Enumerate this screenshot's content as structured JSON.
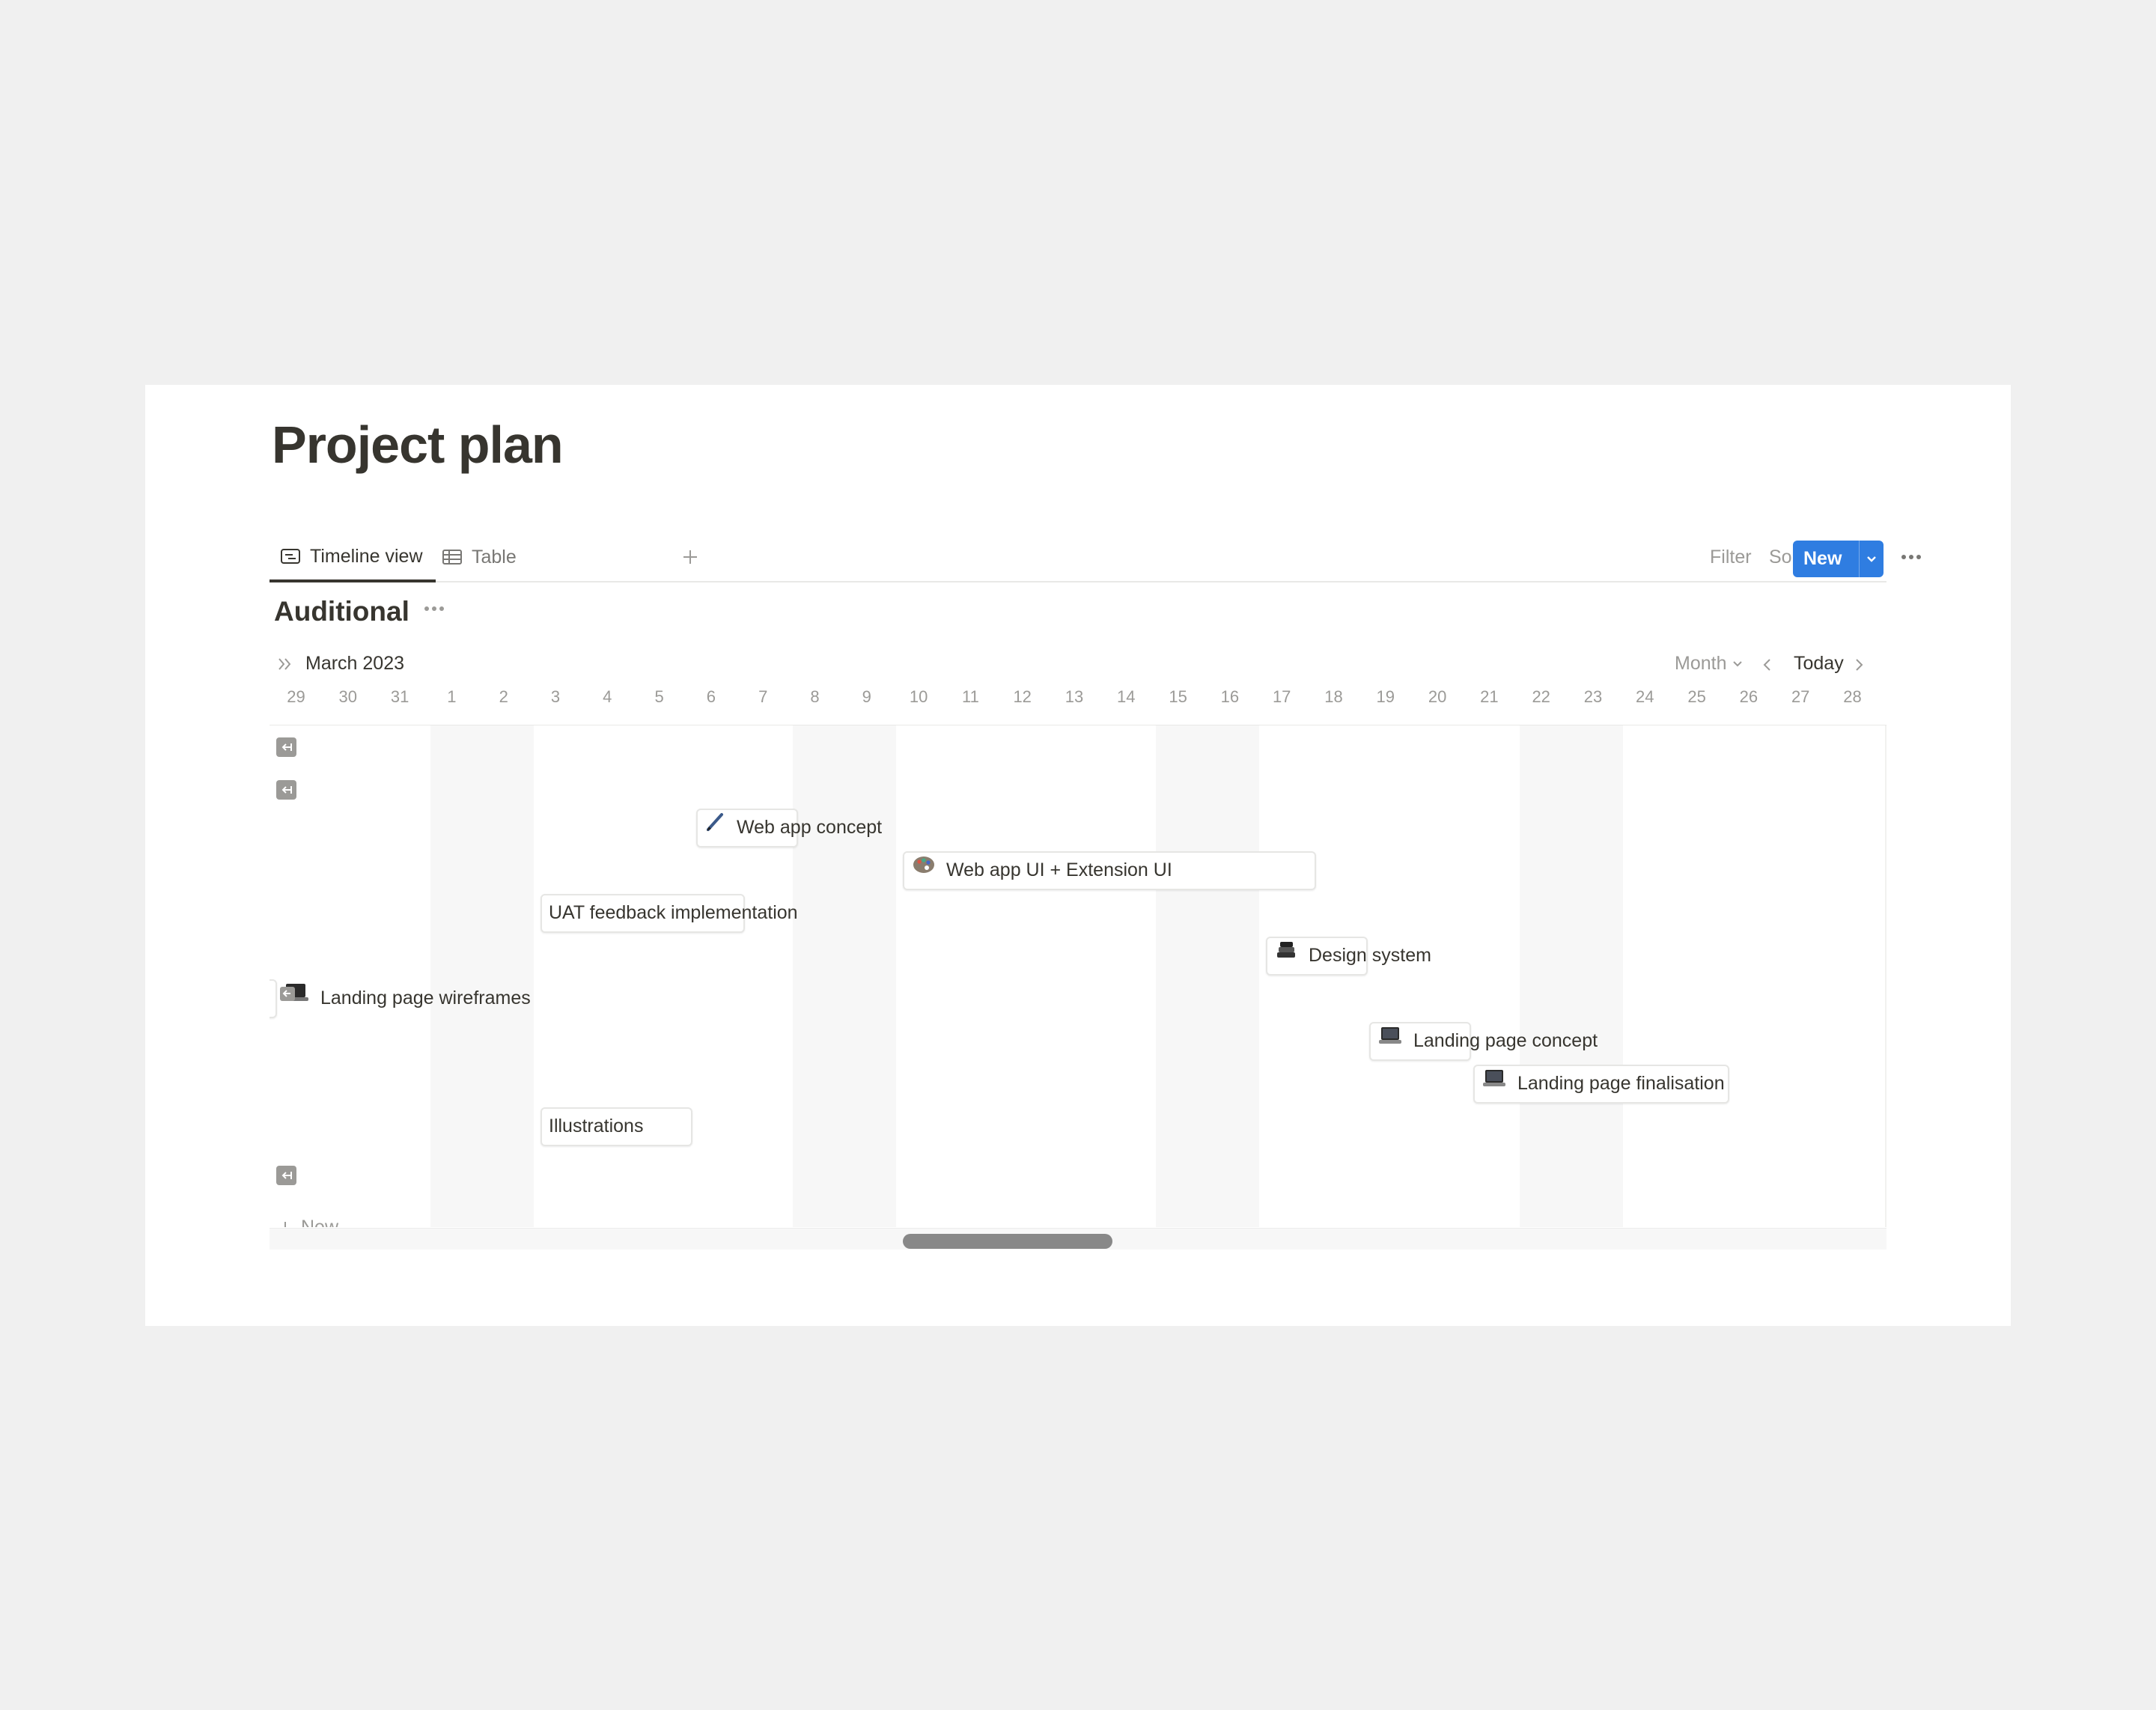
{
  "page": {
    "title": "Project plan"
  },
  "views": {
    "tabs": [
      {
        "label": "Timeline view",
        "icon": "timeline-icon",
        "active": true
      },
      {
        "label": "Table",
        "icon": "table-icon",
        "active": false
      }
    ],
    "add_view_icon": "plus-icon"
  },
  "toolbar": {
    "filter_label": "Filter",
    "sort_label": "Sort",
    "search_icon": "search-icon",
    "expand_icon": "expand-icon",
    "more_icon": "more-icon",
    "new_label": "New",
    "new_accent": "#2f7de1"
  },
  "group": {
    "title": "Auditional"
  },
  "timeline": {
    "month_label": "March 2023",
    "scale_label": "Month",
    "today_label": "Today",
    "days": [
      "29",
      "30",
      "31",
      "1",
      "2",
      "3",
      "4",
      "5",
      "6",
      "7",
      "8",
      "9",
      "10",
      "11",
      "12",
      "13",
      "14",
      "15",
      "16",
      "17",
      "18",
      "19",
      "20",
      "21",
      "22",
      "23",
      "24",
      "25",
      "26",
      "27",
      "28"
    ],
    "items": [
      {
        "label": "Web app concept",
        "icon": "pen-icon"
      },
      {
        "label": "Web app UI + Extension UI",
        "icon": "palette-icon"
      },
      {
        "label": "UAT feedback implementation",
        "icon": ""
      },
      {
        "label": "Design system",
        "icon": "books-icon"
      },
      {
        "label": "Landing page wireframes",
        "icon": "laptop-icon"
      },
      {
        "label": "Landing page concept",
        "icon": "laptop-icon"
      },
      {
        "label": "Landing page finalisation",
        "icon": "laptop-icon"
      },
      {
        "label": "Illustrations",
        "icon": ""
      }
    ],
    "new_row_label": "New"
  }
}
